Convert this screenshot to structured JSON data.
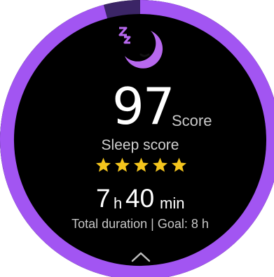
{
  "sleep": {
    "score_value": "97",
    "score_unit": "Score",
    "score_label": "Sleep score",
    "stars_filled": 5,
    "stars_total": 5,
    "duration_hours": "7",
    "duration_hours_unit": "h",
    "duration_minutes": "40",
    "duration_minutes_unit": "min",
    "duration_label": "Total duration | Goal: 8 h",
    "goal_progress": 0.958
  },
  "colors": {
    "background": "#000000",
    "ring_track": "#3b2566",
    "ring_fill": "#a255f2",
    "moon": "#b768ee",
    "star": "#f4c51d",
    "text_primary": "#ffffff",
    "text_secondary": "#c9c9c9"
  },
  "icons": {
    "moon": "sleeping-moon-icon",
    "star": "star-icon",
    "chevron": "chevron-up-icon"
  }
}
